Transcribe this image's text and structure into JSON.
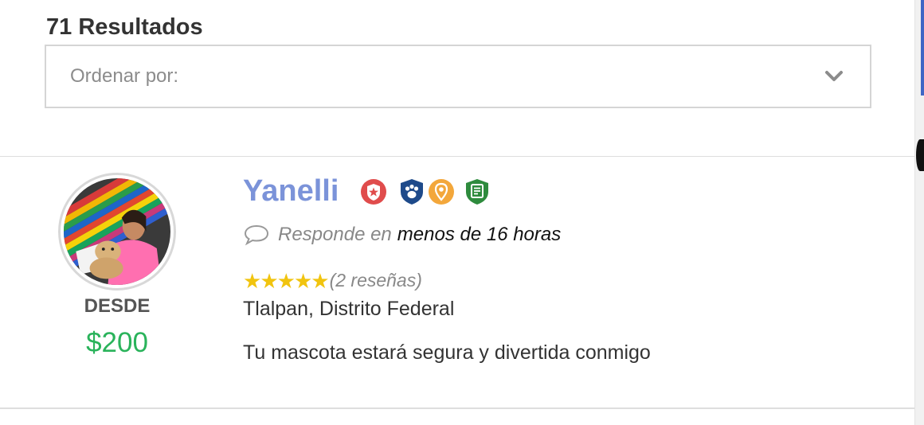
{
  "results": {
    "count_label": "71 Resultados"
  },
  "sort": {
    "placeholder": "Ordenar por:",
    "icon": "chevron-down-icon"
  },
  "colors": {
    "accent_name": "#7b93d9",
    "price": "#2ab35b",
    "star": "#f1c40f"
  },
  "listing": {
    "name": "Yanelli",
    "badges": [
      "star-shield-icon",
      "paw-shield-icon",
      "location-pin-icon",
      "document-check-icon"
    ],
    "response": {
      "label": "Responde en",
      "value": "menos de 16 horas"
    },
    "rating": {
      "stars": 5,
      "max_stars": 5,
      "reviews": "(2 reseñas)"
    },
    "location": "Tlalpan, Distrito Federal",
    "description": "Tu mascota estará segura y divertida conmigo",
    "price": {
      "from_label": "DESDE",
      "amount": "$200"
    }
  }
}
